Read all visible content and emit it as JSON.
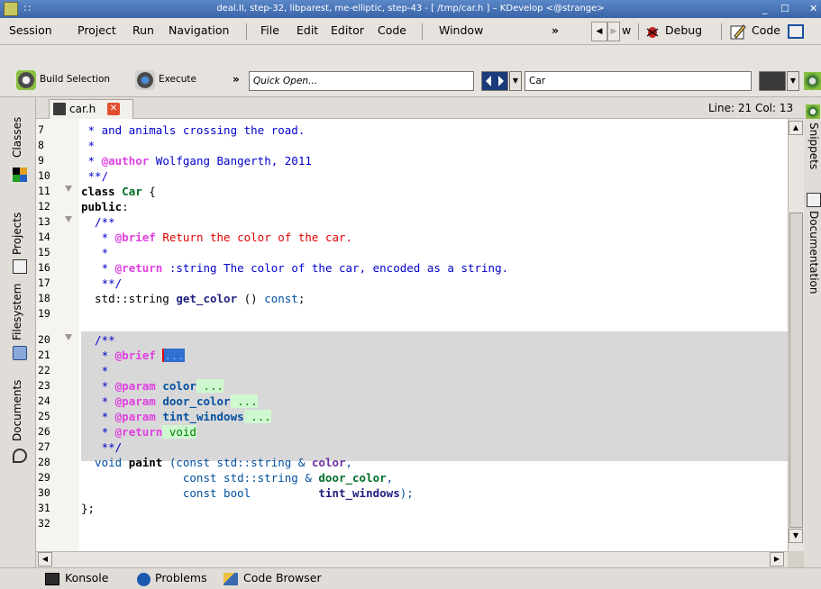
{
  "window": {
    "title": "deal.II, step-32, libparest, me-elliptic, step-43 - [ /tmp/car.h ] – KDevelop <@strange>"
  },
  "menu": {
    "items": [
      "Session",
      "Project",
      "Run",
      "Navigation",
      "File",
      "Edit",
      "Editor",
      "Code",
      "Window"
    ],
    "overflow": "»",
    "nav_w": "w",
    "debug_label": "Debug",
    "code_label": "Code"
  },
  "toolbar": {
    "build_label": "Build Selection",
    "execute_label": "Execute",
    "overflow": "»",
    "quick_open_placeholder": "Quick Open...",
    "class_input_value": "Car"
  },
  "left_dock": {
    "tabs": [
      "Classes",
      "Projects",
      "Filesystem",
      "Documents"
    ]
  },
  "right_dock": {
    "tabs": [
      "Snippets",
      "Documentation"
    ]
  },
  "editor": {
    "tab_label": "car.h",
    "cursor_position": "Line: 21 Col: 13",
    "lines": [
      {
        "n": "7"
      },
      {
        "n": "8"
      },
      {
        "n": "9"
      },
      {
        "n": "10"
      },
      {
        "n": "11"
      },
      {
        "n": "12"
      },
      {
        "n": "13"
      },
      {
        "n": "14"
      },
      {
        "n": "15"
      },
      {
        "n": "16"
      },
      {
        "n": "17"
      },
      {
        "n": "18"
      },
      {
        "n": "19"
      },
      {
        "n": "20"
      },
      {
        "n": "21"
      },
      {
        "n": "22"
      },
      {
        "n": "23"
      },
      {
        "n": "24"
      },
      {
        "n": "25"
      },
      {
        "n": "26"
      },
      {
        "n": "27"
      },
      {
        "n": "28"
      },
      {
        "n": "29"
      },
      {
        "n": "30"
      },
      {
        "n": "31"
      },
      {
        "n": "32"
      }
    ],
    "code": {
      "l7": " * and animals crossing the road.",
      "l8": " *",
      "l9a": " * ",
      "l9b": "@author",
      "l9c": " Wolfgang Bangerth, 2011",
      "l10": " **/",
      "l11a": "class",
      "l11b": " Car",
      "l11c": " {",
      "l12a": "public",
      "l12b": ":",
      "l13": "  /**",
      "l14a": "   * ",
      "l14b": "@brief",
      "l14c": " Return the color of the car.",
      "l15": "   *",
      "l16a": "   * ",
      "l16b": "@return",
      "l16c": " :string The color of the car, encoded as a string.",
      "l17": "   **/",
      "l18a": "  std::string ",
      "l18b": "get_color",
      "l18c": " () ",
      "l18d": "const",
      "l18e": ";",
      "l20": "  /**",
      "l21a": "   * ",
      "l21b": "@brief",
      "l21c": " ",
      "l21d": "...",
      "l22": "   *",
      "l23a": "   * ",
      "l23b": "@param",
      "l23c": " color",
      "l23d": " ...",
      "l24a": "   * ",
      "l24b": "@param",
      "l24c": " door_color",
      "l24d": " ...",
      "l25a": "   * ",
      "l25b": "@param",
      "l25c": " tint_windows",
      "l25d": " ...",
      "l26a": "   * ",
      "l26b": "@return",
      "l26c": " void",
      "l27": "   **/",
      "l28a": "  void ",
      "l28b": "paint",
      "l28c": " (const std::string & ",
      "l28d": "color",
      "l28e": ",",
      "l29a": "               const std::string & ",
      "l29b": "door_color",
      "l29c": ",",
      "l30a": "               const bool          ",
      "l30b": "tint_windows",
      "l30c": ");",
      "l31": "};"
    }
  },
  "bottom": {
    "tabs": [
      "Konsole",
      "Problems",
      "Code Browser"
    ]
  }
}
